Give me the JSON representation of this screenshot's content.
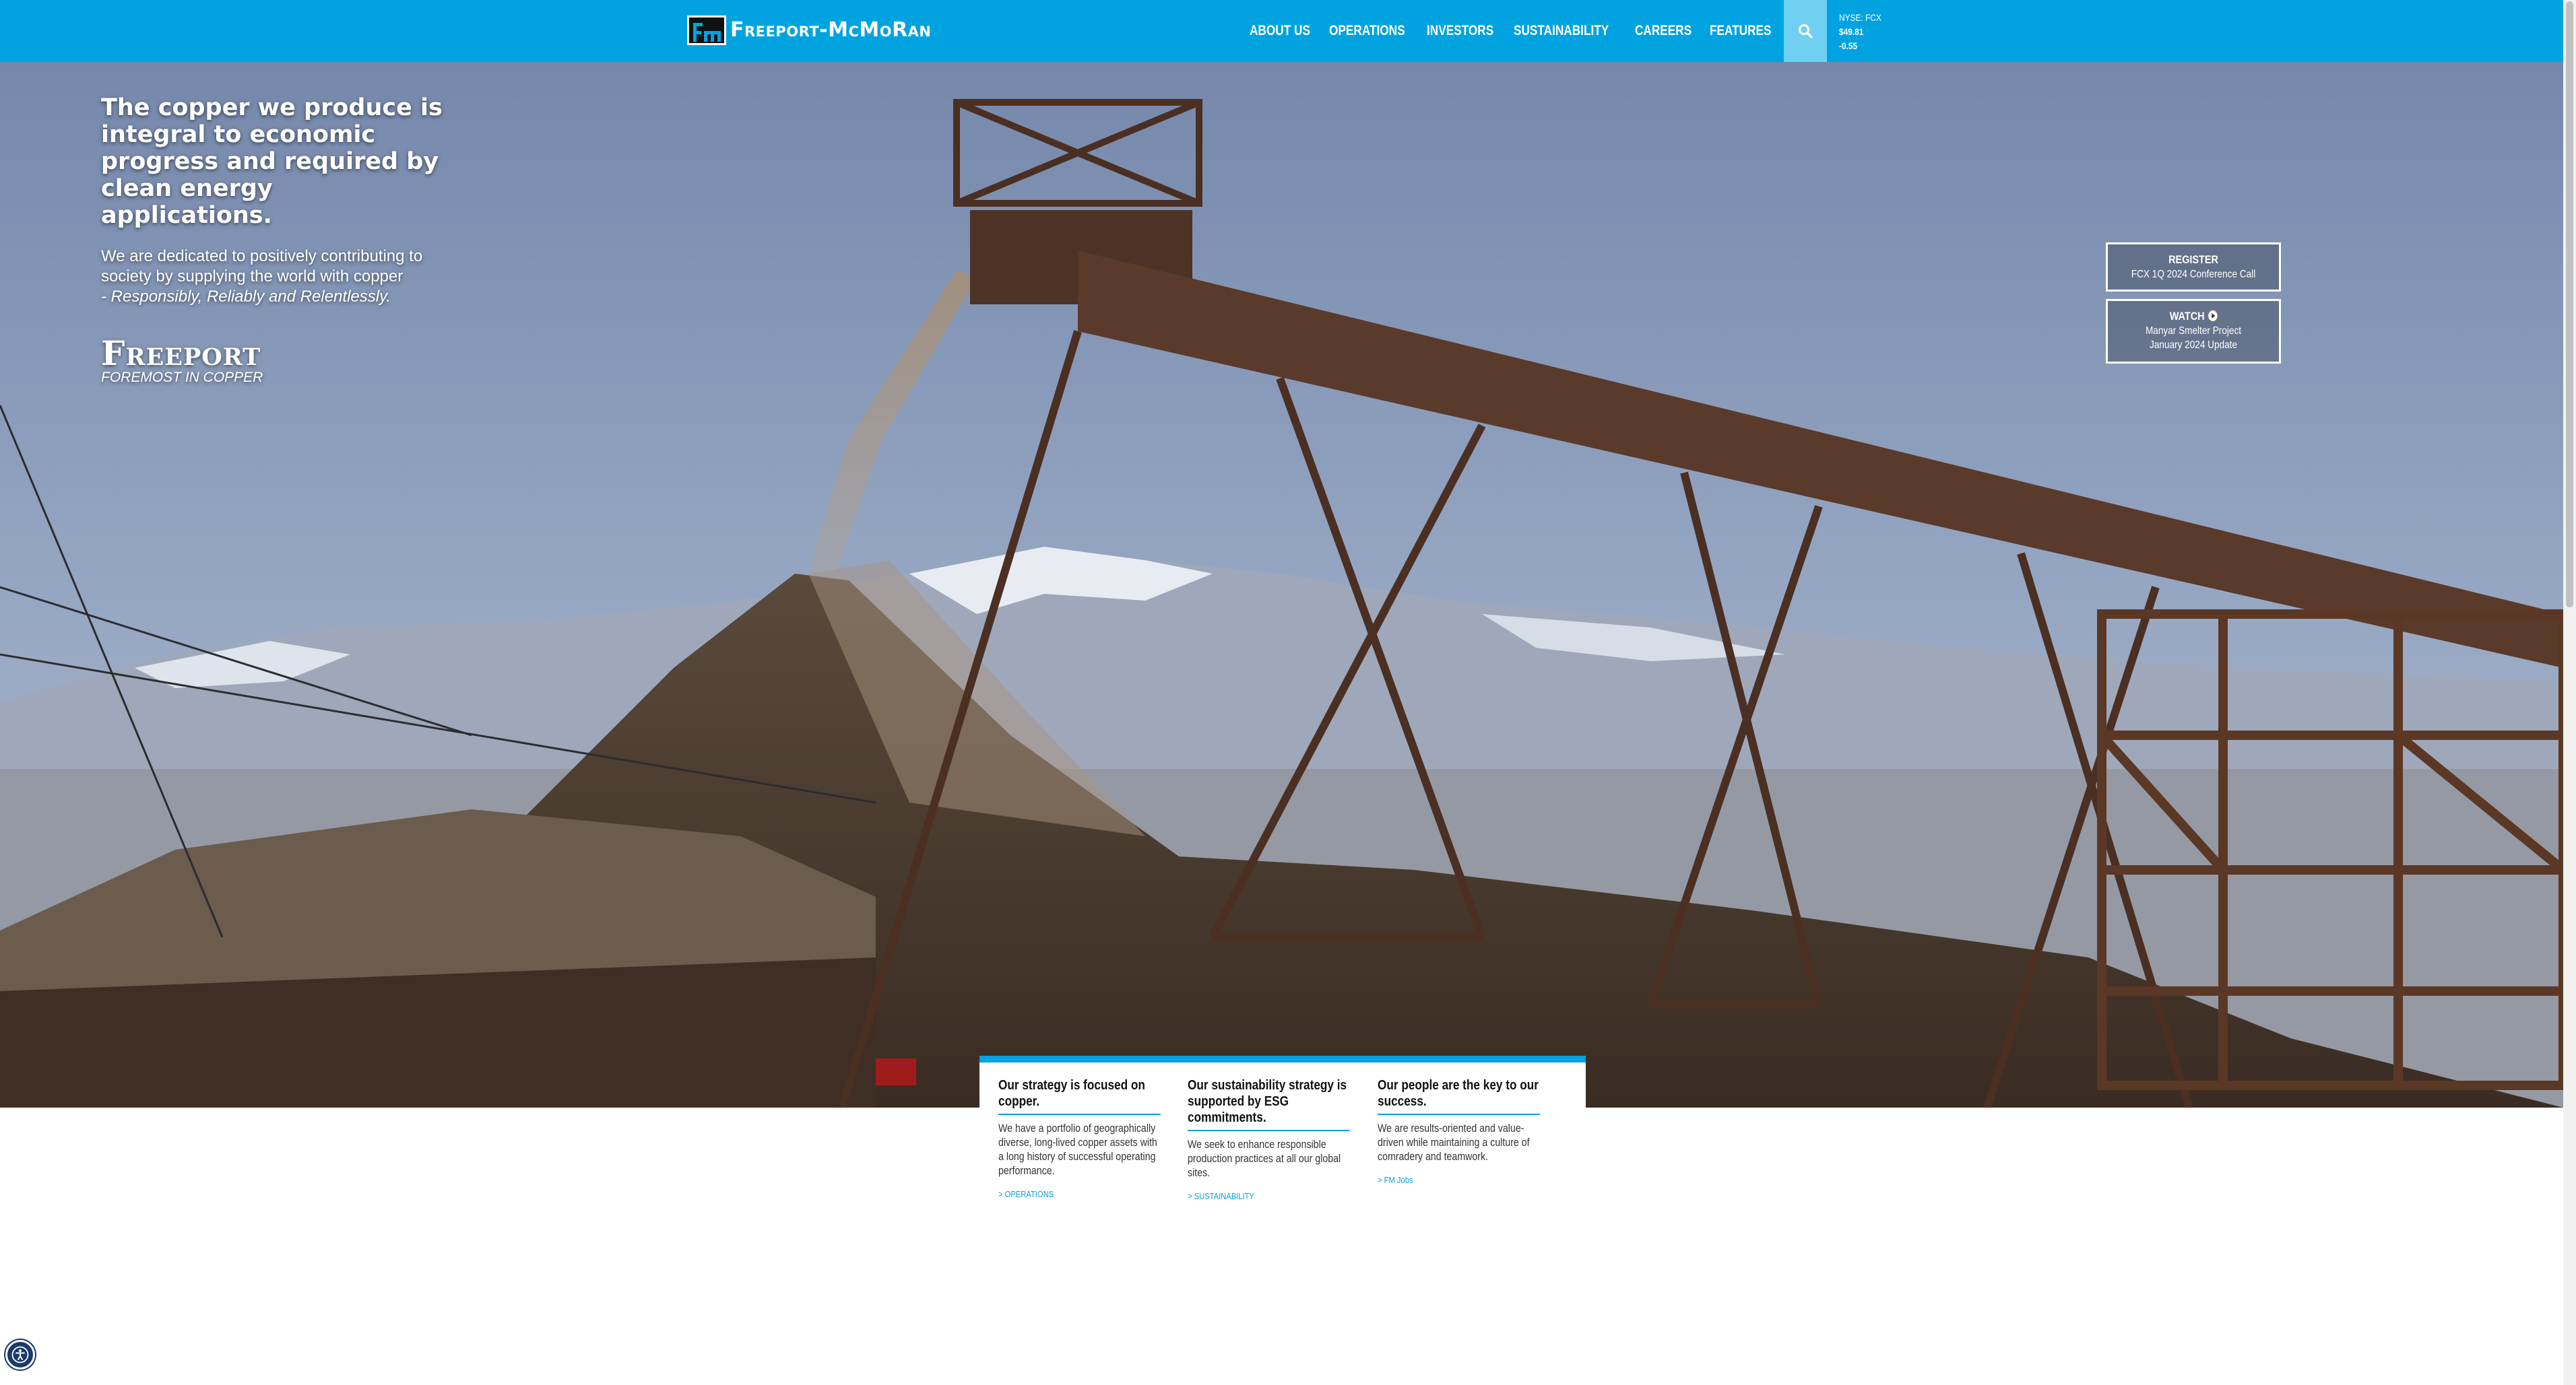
{
  "brand": {
    "logo_text": "Freeport-McMoRan"
  },
  "nav": {
    "items": [
      {
        "label": "ABOUT US"
      },
      {
        "label": "OPERATIONS"
      },
      {
        "label": "INVESTORS"
      },
      {
        "label": "SUSTAINABILITY"
      },
      {
        "label": "CAREERS"
      },
      {
        "label": "FEATURES"
      }
    ],
    "search_icon": "search-icon"
  },
  "ticker": {
    "symbol": "NYSE: FCX",
    "price": "$49.81",
    "change": "-0.55"
  },
  "hero": {
    "headline": "The copper we produce is integral to economic progress and required by clean energy applications.",
    "subtext": "We are dedicated to positively contributing to society by supplying the world with copper",
    "subtext_italic": "- Responsibly, Reliably and Relentlessly.",
    "brand_word": "Freeport",
    "brand_tagline": "FOREMOST IN COPPER"
  },
  "ctas": {
    "register_title": "REGISTER",
    "register_sub": "FCX 1Q 2024 Conference Call",
    "watch_title": "WATCH",
    "watch_sub_1": "Manyar Smelter Project",
    "watch_sub_2": "January 2024 Update"
  },
  "pillars": [
    {
      "title": "Our strategy is focused on copper.",
      "body": "We have a portfolio of geographically diverse, long-lived copper assets with a long history of successful operating performance.",
      "link": "> OPERATIONS"
    },
    {
      "title": "Our sustainability strategy is supported by ESG commitments.",
      "body": "We seek to enhance responsible production practices at all our global sites.",
      "link": "> SUSTAINABILITY"
    },
    {
      "title": "Our people are the key to our success.",
      "body": "We are results-oriented and value-driven while maintaining a culture of comradery and teamwork.",
      "link": "> FM Jobs"
    }
  ],
  "colors": {
    "brand_blue": "#00a3e0",
    "search_bg": "#6fd0f2",
    "accessibility_button": "#1a3a6b"
  }
}
